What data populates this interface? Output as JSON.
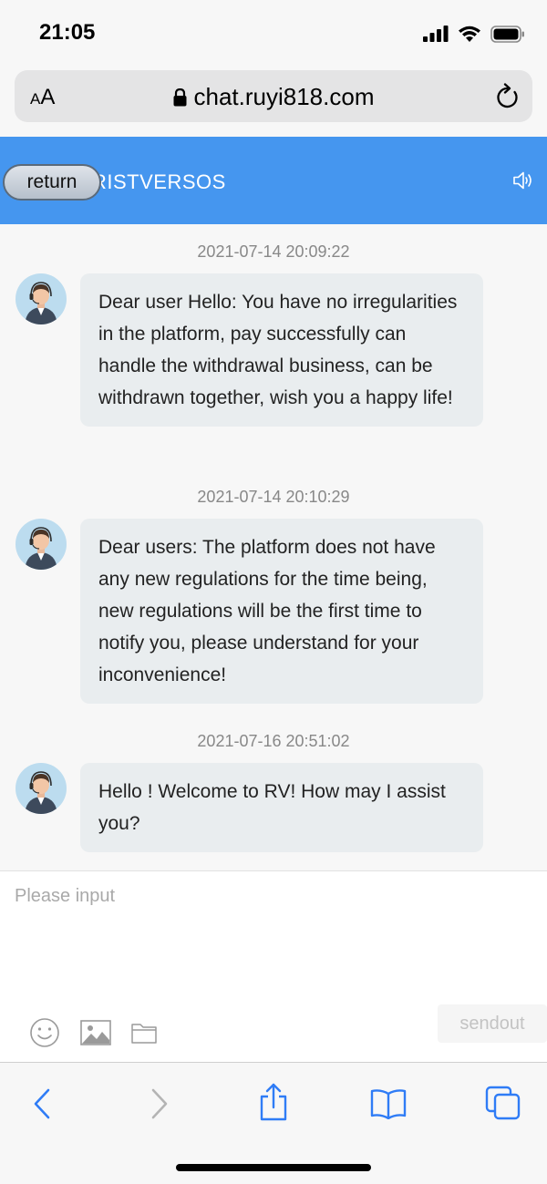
{
  "status_bar": {
    "time": "21:05"
  },
  "browser": {
    "text_size_label_small": "A",
    "text_size_label_large": "A",
    "url": "chat.ruyi818.com"
  },
  "header": {
    "return_label": "return",
    "title": "RISTVERSOS",
    "background_color": "#4596ef"
  },
  "messages": [
    {
      "time": "2021-07-14 20:09:22",
      "text": "Dear user Hello: You have no irregularities in the platform, pay successfully can handle the withdrawal business, can be withdrawn together, wish you a happy life!"
    },
    {
      "time": "2021-07-14 20:10:29",
      "text": "Dear users: The platform does not have any new regulations for the time being, new regulations will be the first time to notify you, please understand for your inconvenience!"
    },
    {
      "time": "2021-07-16 20:51:02",
      "text": "Hello ! Welcome to RV! How may I assist you?"
    }
  ],
  "composer": {
    "placeholder": "Please input",
    "send_label": "sendout",
    "tools": [
      "emoji-icon",
      "image-icon",
      "folder-icon"
    ]
  },
  "safari_toolbar": {
    "items": [
      "back-icon",
      "forward-icon",
      "share-icon",
      "bookmarks-icon",
      "tabs-icon"
    ]
  }
}
